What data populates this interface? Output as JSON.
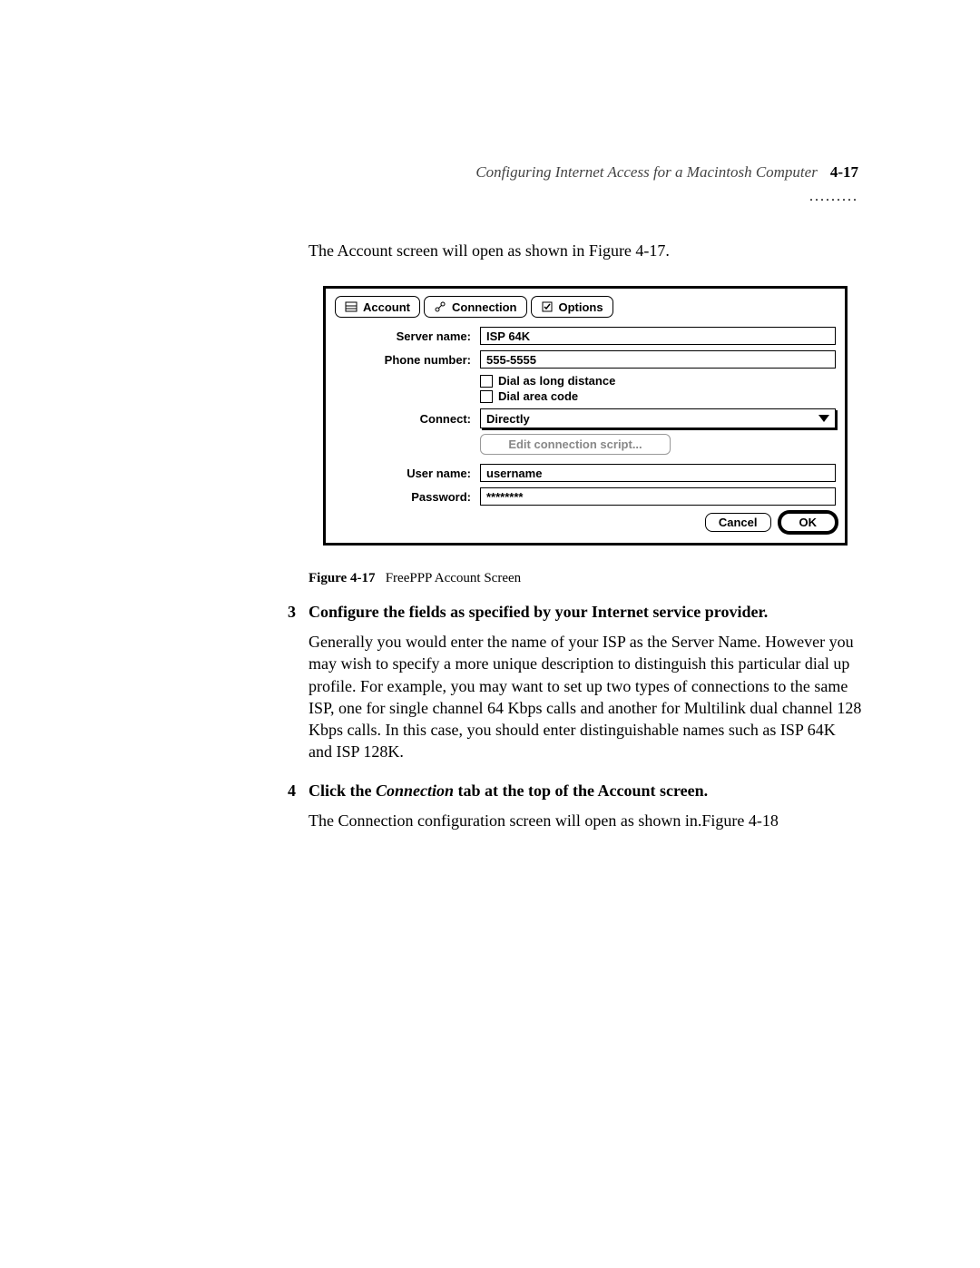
{
  "header": {
    "title": "Configuring Internet Access for a Macintosh Computer",
    "page_number": "4-17",
    "rule": "........."
  },
  "intro_text": "The Account screen will open as shown in Figure 4-17.",
  "dialog": {
    "tabs": {
      "account": "Account",
      "connection": "Connection",
      "options": "Options"
    },
    "labels": {
      "server_name": "Server name:",
      "phone_number": "Phone number:",
      "connect": "Connect:",
      "user_name": "User name:",
      "password": "Password:"
    },
    "values": {
      "server_name": "ISP 64K",
      "phone_number": "555-5555",
      "connect": "Directly",
      "user_name": "username",
      "password": "********"
    },
    "checkboxes": {
      "long_distance": "Dial as long distance",
      "area_code": "Dial area code"
    },
    "edit_script": "Edit connection script...",
    "buttons": {
      "cancel": "Cancel",
      "ok": "OK"
    }
  },
  "caption": {
    "label": "Figure 4-17",
    "text": "FreePPP Account Screen"
  },
  "steps": {
    "s3": {
      "num": "3",
      "head": "Configure the fields as specified by your Internet service provider.",
      "body": "Generally you would enter the name of your ISP as the Server Name. However you may wish to specify a more unique description to distinguish this particular dial up profile. For example, you may want to set up two types of connections to the same ISP, one for single channel 64 Kbps calls and another for Multilink dual channel 128 Kbps calls. In this case, you should enter distinguishable names such as ISP 64K and ISP 128K."
    },
    "s4": {
      "num": "4",
      "head_pre": "Click the ",
      "head_em": "Connection",
      "head_post": " tab at the top of the Account screen.",
      "body": "The Connection configuration screen will open as shown in.Figure 4-18"
    }
  }
}
